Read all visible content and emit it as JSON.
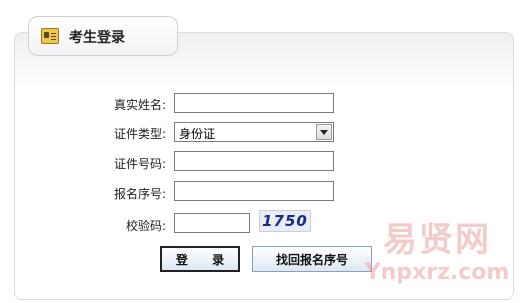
{
  "panel": {
    "tab_title": "考生登录"
  },
  "form": {
    "name_label": "真实姓名:",
    "name_value": "",
    "id_type_label": "证件类型:",
    "id_type_selected": "身份证",
    "id_number_label": "证件号码:",
    "id_number_value": "",
    "reg_no_label": "报名序号:",
    "reg_no_value": "",
    "captcha_label": "校验码:",
    "captcha_value": "",
    "captcha_text": "1750"
  },
  "buttons": {
    "login": "登 录",
    "find_reg_no": "找回报名序号"
  },
  "watermark": {
    "cn": "易贤网",
    "en": "Ynpxrz.com"
  },
  "colors": {
    "captcha_text": "#1b2a8a",
    "watermark": "#e68c8c"
  },
  "icons": {
    "tab": "id-card-icon",
    "select": "chevron-down-icon"
  }
}
